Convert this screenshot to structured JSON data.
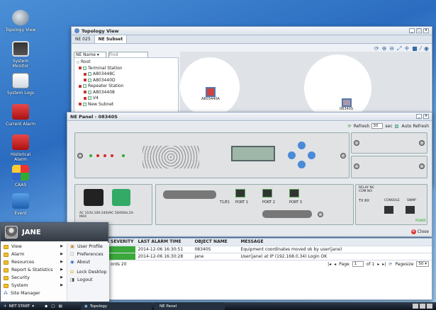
{
  "desktop": {
    "icons": [
      {
        "label": "Topology View"
      },
      {
        "label": "System Monitor"
      },
      {
        "label": "System Logs"
      },
      {
        "label": "Current Alarm"
      },
      {
        "label": "Historical Alarm"
      },
      {
        "label": "CAAS"
      },
      {
        "label": "Event"
      }
    ]
  },
  "topology_window": {
    "title": "Topology View",
    "tabs": [
      "NE 025",
      "NE Subset"
    ],
    "filter": {
      "select_value": "NE Name",
      "find_placeholder": "Find"
    },
    "tree": [
      "Root",
      "Terminal Station",
      "A803448C",
      "A803440D",
      "Repeater Station",
      "A8034408",
      "V4",
      "New Subnet"
    ],
    "map_nodes": [
      "A803440A",
      "08340S"
    ]
  },
  "ne_panel": {
    "title": "NE Panel - 08340S",
    "refresh_label": "Refresh",
    "refresh_value": "30",
    "sec_label": "sec",
    "auto_refresh_label": "Auto Refresh",
    "power_label": "AC 110V,100-240VAC 50/60Hz,5A MAX",
    "ports": [
      "PORT 1",
      "PORT 2",
      "PORT 3"
    ],
    "labels": [
      "T1/E1",
      "TX RX",
      "CONSOLE",
      "SNMP",
      "RELAY NC COM NO",
      "POWER"
    ],
    "close_label": "Close"
  },
  "alarm_table": {
    "columns": [
      "SEVERITY",
      "LAST ALARM TIME",
      "OBJECT NAME",
      "MESSAGE"
    ],
    "rows": [
      {
        "time": "2014-12-06 16:30:51",
        "object": "08340S",
        "message": "Equipment coordinates moved ok by user(jane)"
      },
      {
        "time": "2014-12-06 16:30:28",
        "object": "jane",
        "message": "User(jane) at IP (192.168.0.34) Login OK"
      }
    ],
    "records_text": "ords 20",
    "pager": {
      "page_label": "Page",
      "page_value": "1",
      "of_label": "of 1",
      "pagesize_label": "Pagesize",
      "pagesize_value": "50"
    }
  },
  "start_menu": {
    "user": "JANE",
    "left_items": [
      "View",
      "Alarm",
      "Resources",
      "Report & Statistics",
      "Security",
      "System",
      "Site Manager"
    ],
    "right_items": [
      "User Profile",
      "Preferences",
      "About",
      "Lock Desktop",
      "Logout"
    ]
  },
  "taskbar": {
    "start_label": "NET START",
    "items": [
      "Topology",
      "NE Panel"
    ]
  },
  "colors": {
    "accent": "#2b6cc0",
    "ok_green": "#3aa83a",
    "alarm_red": "#d03030"
  }
}
